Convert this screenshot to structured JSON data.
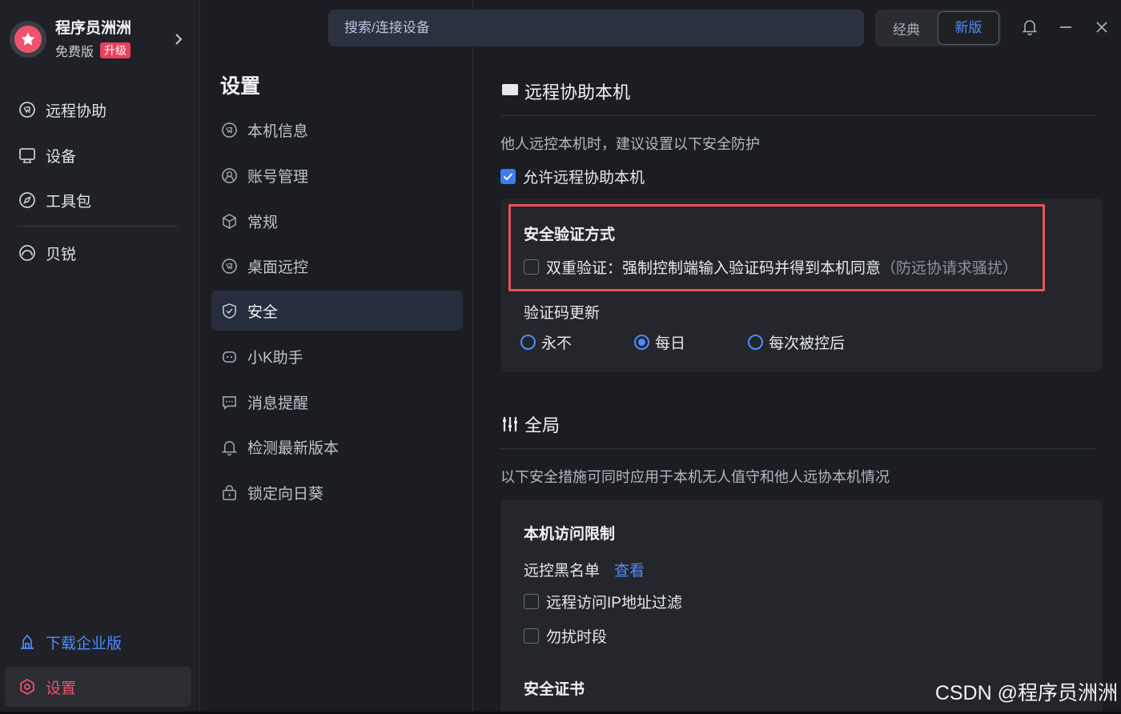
{
  "profile": {
    "name": "程序员洲洲",
    "plan": "免费版",
    "upgrade": "升级"
  },
  "sidebar": {
    "items": [
      {
        "label": "远程协助",
        "icon": "remote-assist-icon"
      },
      {
        "label": "设备",
        "icon": "monitor-icon"
      },
      {
        "label": "工具包",
        "icon": "compass-icon"
      },
      {
        "label": "贝锐",
        "icon": "oray-icon"
      }
    ],
    "download": "下载企业版",
    "settings": "设置"
  },
  "settings_nav": {
    "title": "设置",
    "items": [
      {
        "label": "本机信息",
        "icon": "remote-assist-icon"
      },
      {
        "label": "账号管理",
        "icon": "account-icon"
      },
      {
        "label": "常规",
        "icon": "cube-icon"
      },
      {
        "label": "桌面远控",
        "icon": "remote-assist-icon"
      },
      {
        "label": "安全",
        "icon": "shield-icon",
        "active": true
      },
      {
        "label": "小K助手",
        "icon": "robot-icon"
      },
      {
        "label": "消息提醒",
        "icon": "message-icon"
      },
      {
        "label": "检测最新版本",
        "icon": "bell-icon"
      },
      {
        "label": "锁定向日葵",
        "icon": "lock-icon"
      }
    ]
  },
  "topbar": {
    "search_placeholder": "搜索/连接设备",
    "mode_classic": "经典",
    "mode_new": "新版"
  },
  "content": {
    "remote_section": {
      "title": "远程协助本机",
      "desc": "他人远控本机时，建议设置以下安全防护",
      "allow_label": "允许远程协助本机",
      "allow_checked": true,
      "verify_title": "安全验证方式",
      "dual_verify_label": "双重验证：强制控制端输入验证码并得到本机同意",
      "dual_verify_hint": "（防远协请求骚扰）",
      "dual_verify_checked": false,
      "code_update_title": "验证码更新",
      "radio_options": [
        "永不",
        "每日",
        "每次被控后"
      ],
      "radio_selected": "每日"
    },
    "global_section": {
      "title": "全局",
      "desc": "以下安全措施可同时应用于本机无人值守和他人远协本机情况",
      "access_title": "本机访问限制",
      "blacklist_label": "远控黑名单",
      "blacklist_link": "查看",
      "ip_filter_label": "远程访问IP地址过滤",
      "dnd_label": "勿扰时段",
      "cert_title": "安全证书"
    }
  },
  "watermark": "CSDN @程序员洲洲",
  "colors": {
    "accent": "#4f8cff",
    "danger": "#e9415d",
    "highlight": "#e9525a"
  }
}
